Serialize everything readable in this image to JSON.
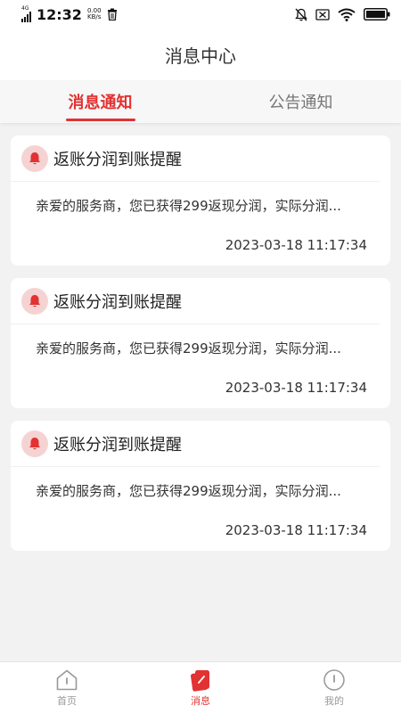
{
  "status_bar": {
    "time": "12:32",
    "network_type": "4G",
    "net_speed_value": "0.00",
    "net_speed_unit": "KB/s"
  },
  "header": {
    "title": "消息中心"
  },
  "tabs": [
    {
      "label": "消息通知",
      "active": true
    },
    {
      "label": "公告通知",
      "active": false
    }
  ],
  "messages": [
    {
      "title": "返账分润到账提醒",
      "body": "亲爱的服务商，您已获得299返现分润，实际分润...",
      "time": "2023-03-18 11:17:34"
    },
    {
      "title": "返账分润到账提醒",
      "body": "亲爱的服务商，您已获得299返现分润，实际分润...",
      "time": "2023-03-18 11:17:34"
    },
    {
      "title": "返账分润到账提醒",
      "body": "亲爱的服务商，您已获得299返现分润，实际分润...",
      "time": "2023-03-18 11:17:34"
    }
  ],
  "bottom_nav": [
    {
      "label": "首页",
      "icon": "home-icon",
      "active": false
    },
    {
      "label": "消息",
      "icon": "message-icon",
      "active": true
    },
    {
      "label": "我的",
      "icon": "profile-icon",
      "active": false
    }
  ],
  "colors": {
    "accent": "#e23232",
    "bell_bg": "#f6d3d3",
    "page_bg": "#f2f2f2"
  }
}
